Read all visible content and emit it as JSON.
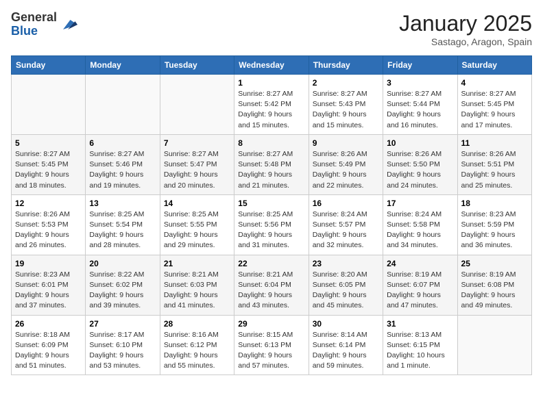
{
  "header": {
    "logo_general": "General",
    "logo_blue": "Blue",
    "title": "January 2025",
    "subtitle": "Sastago, Aragon, Spain"
  },
  "weekdays": [
    "Sunday",
    "Monday",
    "Tuesday",
    "Wednesday",
    "Thursday",
    "Friday",
    "Saturday"
  ],
  "weeks": [
    [
      {
        "day": "",
        "sunrise": "",
        "sunset": "",
        "daylight": ""
      },
      {
        "day": "",
        "sunrise": "",
        "sunset": "",
        "daylight": ""
      },
      {
        "day": "",
        "sunrise": "",
        "sunset": "",
        "daylight": ""
      },
      {
        "day": "1",
        "sunrise": "Sunrise: 8:27 AM",
        "sunset": "Sunset: 5:42 PM",
        "daylight": "Daylight: 9 hours and 15 minutes."
      },
      {
        "day": "2",
        "sunrise": "Sunrise: 8:27 AM",
        "sunset": "Sunset: 5:43 PM",
        "daylight": "Daylight: 9 hours and 15 minutes."
      },
      {
        "day": "3",
        "sunrise": "Sunrise: 8:27 AM",
        "sunset": "Sunset: 5:44 PM",
        "daylight": "Daylight: 9 hours and 16 minutes."
      },
      {
        "day": "4",
        "sunrise": "Sunrise: 8:27 AM",
        "sunset": "Sunset: 5:45 PM",
        "daylight": "Daylight: 9 hours and 17 minutes."
      }
    ],
    [
      {
        "day": "5",
        "sunrise": "Sunrise: 8:27 AM",
        "sunset": "Sunset: 5:45 PM",
        "daylight": "Daylight: 9 hours and 18 minutes."
      },
      {
        "day": "6",
        "sunrise": "Sunrise: 8:27 AM",
        "sunset": "Sunset: 5:46 PM",
        "daylight": "Daylight: 9 hours and 19 minutes."
      },
      {
        "day": "7",
        "sunrise": "Sunrise: 8:27 AM",
        "sunset": "Sunset: 5:47 PM",
        "daylight": "Daylight: 9 hours and 20 minutes."
      },
      {
        "day": "8",
        "sunrise": "Sunrise: 8:27 AM",
        "sunset": "Sunset: 5:48 PM",
        "daylight": "Daylight: 9 hours and 21 minutes."
      },
      {
        "day": "9",
        "sunrise": "Sunrise: 8:26 AM",
        "sunset": "Sunset: 5:49 PM",
        "daylight": "Daylight: 9 hours and 22 minutes."
      },
      {
        "day": "10",
        "sunrise": "Sunrise: 8:26 AM",
        "sunset": "Sunset: 5:50 PM",
        "daylight": "Daylight: 9 hours and 24 minutes."
      },
      {
        "day": "11",
        "sunrise": "Sunrise: 8:26 AM",
        "sunset": "Sunset: 5:51 PM",
        "daylight": "Daylight: 9 hours and 25 minutes."
      }
    ],
    [
      {
        "day": "12",
        "sunrise": "Sunrise: 8:26 AM",
        "sunset": "Sunset: 5:53 PM",
        "daylight": "Daylight: 9 hours and 26 minutes."
      },
      {
        "day": "13",
        "sunrise": "Sunrise: 8:25 AM",
        "sunset": "Sunset: 5:54 PM",
        "daylight": "Daylight: 9 hours and 28 minutes."
      },
      {
        "day": "14",
        "sunrise": "Sunrise: 8:25 AM",
        "sunset": "Sunset: 5:55 PM",
        "daylight": "Daylight: 9 hours and 29 minutes."
      },
      {
        "day": "15",
        "sunrise": "Sunrise: 8:25 AM",
        "sunset": "Sunset: 5:56 PM",
        "daylight": "Daylight: 9 hours and 31 minutes."
      },
      {
        "day": "16",
        "sunrise": "Sunrise: 8:24 AM",
        "sunset": "Sunset: 5:57 PM",
        "daylight": "Daylight: 9 hours and 32 minutes."
      },
      {
        "day": "17",
        "sunrise": "Sunrise: 8:24 AM",
        "sunset": "Sunset: 5:58 PM",
        "daylight": "Daylight: 9 hours and 34 minutes."
      },
      {
        "day": "18",
        "sunrise": "Sunrise: 8:23 AM",
        "sunset": "Sunset: 5:59 PM",
        "daylight": "Daylight: 9 hours and 36 minutes."
      }
    ],
    [
      {
        "day": "19",
        "sunrise": "Sunrise: 8:23 AM",
        "sunset": "Sunset: 6:01 PM",
        "daylight": "Daylight: 9 hours and 37 minutes."
      },
      {
        "day": "20",
        "sunrise": "Sunrise: 8:22 AM",
        "sunset": "Sunset: 6:02 PM",
        "daylight": "Daylight: 9 hours and 39 minutes."
      },
      {
        "day": "21",
        "sunrise": "Sunrise: 8:21 AM",
        "sunset": "Sunset: 6:03 PM",
        "daylight": "Daylight: 9 hours and 41 minutes."
      },
      {
        "day": "22",
        "sunrise": "Sunrise: 8:21 AM",
        "sunset": "Sunset: 6:04 PM",
        "daylight": "Daylight: 9 hours and 43 minutes."
      },
      {
        "day": "23",
        "sunrise": "Sunrise: 8:20 AM",
        "sunset": "Sunset: 6:05 PM",
        "daylight": "Daylight: 9 hours and 45 minutes."
      },
      {
        "day": "24",
        "sunrise": "Sunrise: 8:19 AM",
        "sunset": "Sunset: 6:07 PM",
        "daylight": "Daylight: 9 hours and 47 minutes."
      },
      {
        "day": "25",
        "sunrise": "Sunrise: 8:19 AM",
        "sunset": "Sunset: 6:08 PM",
        "daylight": "Daylight: 9 hours and 49 minutes."
      }
    ],
    [
      {
        "day": "26",
        "sunrise": "Sunrise: 8:18 AM",
        "sunset": "Sunset: 6:09 PM",
        "daylight": "Daylight: 9 hours and 51 minutes."
      },
      {
        "day": "27",
        "sunrise": "Sunrise: 8:17 AM",
        "sunset": "Sunset: 6:10 PM",
        "daylight": "Daylight: 9 hours and 53 minutes."
      },
      {
        "day": "28",
        "sunrise": "Sunrise: 8:16 AM",
        "sunset": "Sunset: 6:12 PM",
        "daylight": "Daylight: 9 hours and 55 minutes."
      },
      {
        "day": "29",
        "sunrise": "Sunrise: 8:15 AM",
        "sunset": "Sunset: 6:13 PM",
        "daylight": "Daylight: 9 hours and 57 minutes."
      },
      {
        "day": "30",
        "sunrise": "Sunrise: 8:14 AM",
        "sunset": "Sunset: 6:14 PM",
        "daylight": "Daylight: 9 hours and 59 minutes."
      },
      {
        "day": "31",
        "sunrise": "Sunrise: 8:13 AM",
        "sunset": "Sunset: 6:15 PM",
        "daylight": "Daylight: 10 hours and 1 minute."
      },
      {
        "day": "",
        "sunrise": "",
        "sunset": "",
        "daylight": ""
      }
    ]
  ]
}
